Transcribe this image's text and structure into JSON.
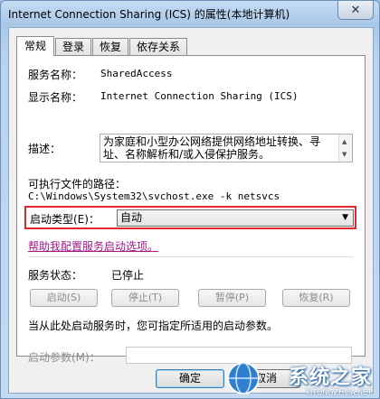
{
  "window": {
    "title": "Internet Connection Sharing (ICS) 的属性(本地计算机)",
    "close_glyph": "✕"
  },
  "tabs": [
    {
      "label": "常规",
      "active": true
    },
    {
      "label": "登录",
      "active": false
    },
    {
      "label": "恢复",
      "active": false
    },
    {
      "label": "依存关系",
      "active": false
    }
  ],
  "general": {
    "service_name_label": "服务名称：",
    "service_name_value": "SharedAccess",
    "display_name_label": "显示名称：",
    "display_name_value": "Internet Connection Sharing (ICS)",
    "description_label": "描述：",
    "description_value": "为家庭和小型办公网络提供网络地址转换、寻址、名称解析和/或入侵保护服务。",
    "exe_path_label": "可执行文件的路径：",
    "exe_path_value": "C:\\Windows\\System32\\svchost.exe -k netsvcs",
    "startup_type_label": "启动类型(E)：",
    "startup_type_value": "自动",
    "help_link": "帮助我配置服务启动选项。",
    "status_label": "服务状态：",
    "status_value": "已停止",
    "buttons": {
      "start": "启动(S)",
      "stop": "停止(T)",
      "pause": "暂停(P)",
      "resume": "恢复(R)"
    },
    "hint": "当从此处启动服务时，您可指定所适用的启动参数。",
    "start_params_label": "启动参数(M)：",
    "start_params_value": ""
  },
  "footer": {
    "ok": "确定",
    "cancel": "取消"
  },
  "watermark": {
    "brand": "系统之家",
    "url": "XITONGZHIJIA.NET"
  },
  "colors": {
    "highlight_border": "#e0282c",
    "link": "#a0168d"
  }
}
